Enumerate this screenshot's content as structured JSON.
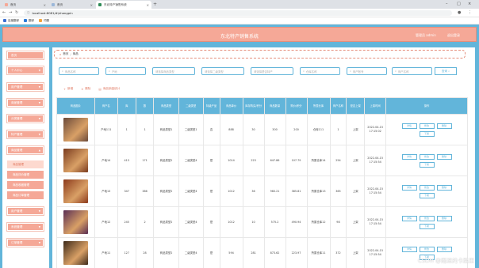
{
  "browser": {
    "tabs": [
      {
        "label": "首页",
        "favicon_color": "#f5a897"
      },
      {
        "label": "首页",
        "favicon_color": "#9bb7d9"
      },
      {
        "label": "东北特产销售系统",
        "favicon_color": "#2e8b57"
      }
    ],
    "url": "localhost:8081/#/shangpin",
    "bookmarks": [
      {
        "label": "百度翻译",
        "color": "#3b6fd3"
      },
      {
        "label": "翻译",
        "color": "#2a7ad9"
      },
      {
        "label": "词霸",
        "color": "#f2a33b"
      }
    ]
  },
  "header": {
    "title": "东北特产销售系统",
    "admin_link": "管理员 admin",
    "logout_link": "退出登录"
  },
  "sidebar": {
    "items": [
      {
        "label": "首页"
      },
      {
        "label": "个人中心"
      },
      {
        "label": "用户管理"
      },
      {
        "label": "商家管理"
      },
      {
        "label": "分类管理"
      },
      {
        "label": "特产管理"
      },
      {
        "label": "商品管理"
      }
    ],
    "sub_items": [
      {
        "label": "商品管理",
        "selected": true
      },
      {
        "label": "商品评价管理",
        "selected": false
      },
      {
        "label": "商品收藏管理",
        "selected": false
      },
      {
        "label": "商品订单管理",
        "selected": false
      }
    ],
    "bottom_items": [
      {
        "label": "用户管理"
      },
      {
        "label": "系统管理"
      },
      {
        "label": "订单管理"
      }
    ]
  },
  "breadcrumb": {
    "home": "首页",
    "current": "商品"
  },
  "search": {
    "fields": [
      "商品名称",
      "产地",
      "请选择商品类型",
      "请选择二级类型",
      "请选择是否特产",
      "仓库名称",
      "商户账号",
      "商户名称"
    ],
    "button": "查询"
  },
  "actions": {
    "add": "新增",
    "delete": "删除",
    "report": "商品销量统计"
  },
  "table": {
    "columns": [
      "商品图片",
      "商户名",
      "库",
      "数",
      "商品类型",
      "二级类型",
      "特级产品",
      "商品单价",
      "库存购买/积分",
      "商品数量",
      "购价/积分",
      "所属仓库",
      "商户名称",
      "是否上架",
      "上架时间",
      "操作"
    ],
    "rows": [
      {
        "thumb_color": "#6b4a3a",
        "cells": [
          "产地111",
          "1",
          "1",
          "商品类型1",
          "二级类型1",
          "否",
          "888",
          "30",
          "300",
          "200",
          "仓库111",
          "1",
          "上架",
          "2022-04-15 17:15:02"
        ]
      },
      {
        "thumb_color": "#7a3b1e",
        "cells": [
          "产地14",
          "413",
          "171",
          "商品类型2",
          "二级类型4",
          "是",
          "1014",
          "223",
          "647.86",
          "107.79",
          "所属仓库14",
          "254",
          "上架",
          "2022-04-15 17:15:54"
        ]
      },
      {
        "thumb_color": "#8c3a1c",
        "cells": [
          "产地13",
          "347",
          "386",
          "商品类型2",
          "二级类型4",
          "是",
          "1012",
          "36",
          "960.21",
          "385.81",
          "所属仓库13",
          "365",
          "上架",
          "2022-04-15 17:15:54"
        ]
      },
      {
        "thumb_color": "#5a2e54",
        "cells": [
          "产地12",
          "245",
          "2",
          "商品类型2",
          "二级类型4",
          "是",
          "1012",
          "10",
          "575.2",
          "490.94",
          "所属仓库12",
          "98",
          "上架",
          "2022-04-15 17:15:54"
        ]
      },
      {
        "thumb_color": "#3d2a1a",
        "cells": [
          "产地11",
          "127",
          "28",
          "商品类型2",
          "二级类型4",
          "是",
          "594",
          "281",
          "873.62",
          "223.97",
          "所属仓库11",
          "372",
          "上架",
          "2022-04-15 17:15:54"
        ]
      }
    ],
    "op_labels": {
      "detail": "详情",
      "edit": "修改",
      "delete": "删除",
      "offline": "下架"
    }
  },
  "watermark": "CSDN @雨逗的卡路里"
}
